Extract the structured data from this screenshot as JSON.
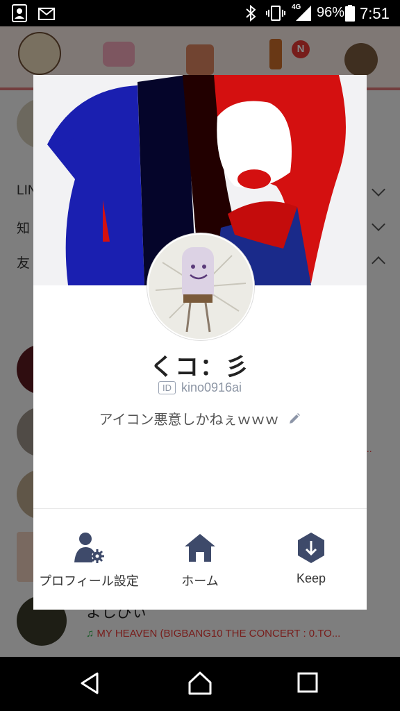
{
  "status_bar": {
    "battery_percent": "96%",
    "time": "7:51",
    "network": "4G",
    "icons": [
      "contact-card-icon",
      "message-icon",
      "bluetooth-icon",
      "vibrate-icon",
      "signal-icon",
      "battery-icon"
    ]
  },
  "background": {
    "notification_badge": "N",
    "rows": [
      "LIN",
      "知",
      "友"
    ],
    "friend_name": "よしびぃ",
    "friend_status": "MY HEAVEN (BIGBANG10 THE CONCERT : 0.TO...",
    "pink_text": "..."
  },
  "profile": {
    "name": "くコ：彡",
    "id_badge": "ID",
    "user_id": "kino0916ai",
    "status_message": "アイコン悪意しかねぇｗｗｗ"
  },
  "actions": [
    {
      "label": "プロフィール設定",
      "icon": "profile-settings-icon"
    },
    {
      "label": "ホーム",
      "icon": "home-icon"
    },
    {
      "label": "Keep",
      "icon": "keep-icon"
    }
  ],
  "colors": {
    "icon_navy": "#3e4a6a",
    "badge_red": "#e53935",
    "cover_blue": "#1a1fb0",
    "cover_red": "#d41010"
  },
  "nav_bar": {
    "icons": [
      "back-icon",
      "home-nav-icon",
      "recents-icon"
    ]
  }
}
